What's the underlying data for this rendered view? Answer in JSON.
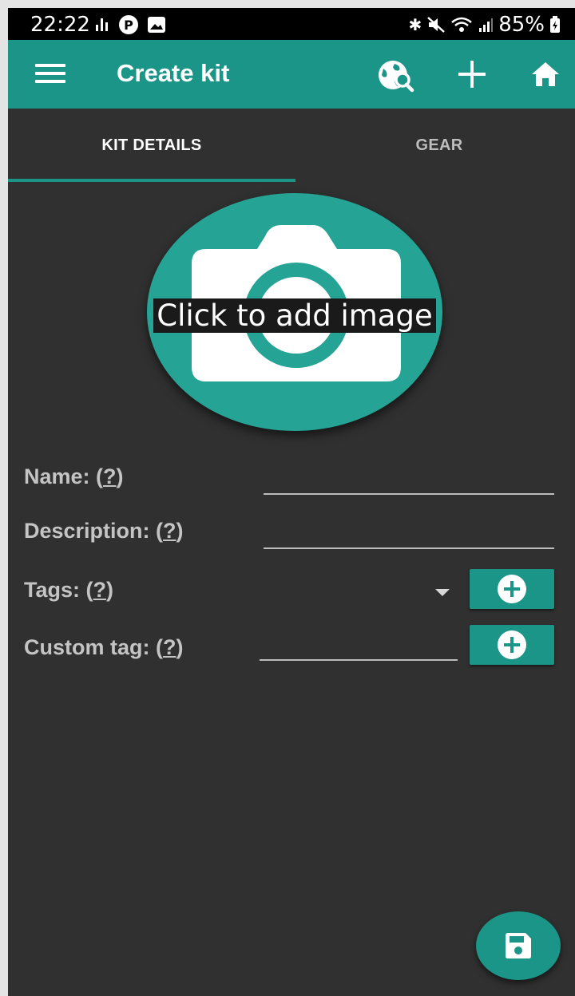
{
  "status_bar": {
    "time": "22:22",
    "battery": "85%"
  },
  "app_bar": {
    "title": "Create kit",
    "icons": [
      "menu-icon",
      "globe-search-icon",
      "plus-icon",
      "home-icon"
    ]
  },
  "tabs": [
    {
      "label": "KIT DETAILS",
      "selected": true
    },
    {
      "label": "GEAR",
      "selected": false
    }
  ],
  "image_picker": {
    "caption": "Click to add image",
    "icon": "camera-icon"
  },
  "form": {
    "name_label": "Name:",
    "description_label": "Description:",
    "tags_label": "Tags:",
    "custom_tag_label": "Custom tag:",
    "help_mark": "?",
    "name_value": "",
    "description_value": "",
    "custom_tag_value": ""
  },
  "colors": {
    "accent": "#1a9587",
    "background": "#303030",
    "label": "#c4c4c4"
  },
  "fab": {
    "icon": "save-icon"
  }
}
